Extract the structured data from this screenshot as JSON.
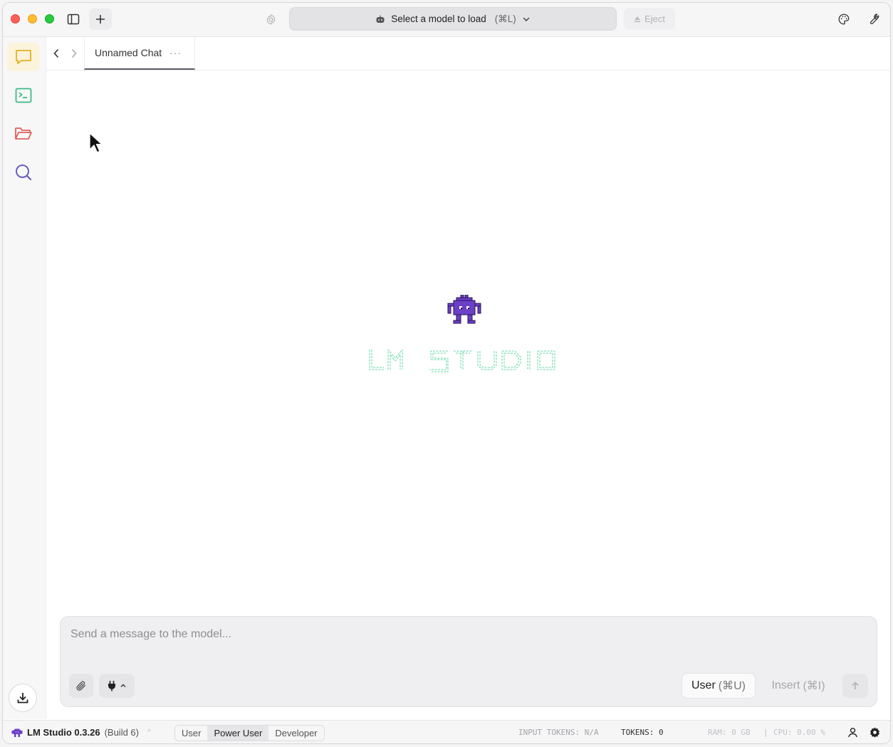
{
  "titlebar": {
    "model_select_label": "Select a model to load",
    "model_select_shortcut": "(⌘L)",
    "eject_label": "Eject"
  },
  "tabs": [
    {
      "label": "Unnamed Chat",
      "menu": "···"
    }
  ],
  "composer": {
    "placeholder": "Send a message to the model...",
    "role_label": "User",
    "role_shortcut": "(⌘U)",
    "insert_label": "Insert",
    "insert_shortcut": "(⌘I)"
  },
  "statusbar": {
    "app_name": "LM Studio 0.3.26",
    "build": "(Build 6)",
    "modes": [
      "User",
      "Power User",
      "Developer"
    ],
    "active_mode": "Power User",
    "input_tokens": "INPUT TOKENS: N/A",
    "tokens": "TOKENS: 0",
    "ram": "RAM: 0 GB",
    "separator": "|",
    "cpu": "CPU: 0.00 %"
  },
  "colors": {
    "accent_purple": "#6c3fc7",
    "chat_icon": "#e1b21f",
    "developer_icon": "#3fba8a",
    "folder_icon": "#e0625c",
    "search_icon": "#6a5fc1",
    "brand_outline": "#5fd7a3"
  }
}
